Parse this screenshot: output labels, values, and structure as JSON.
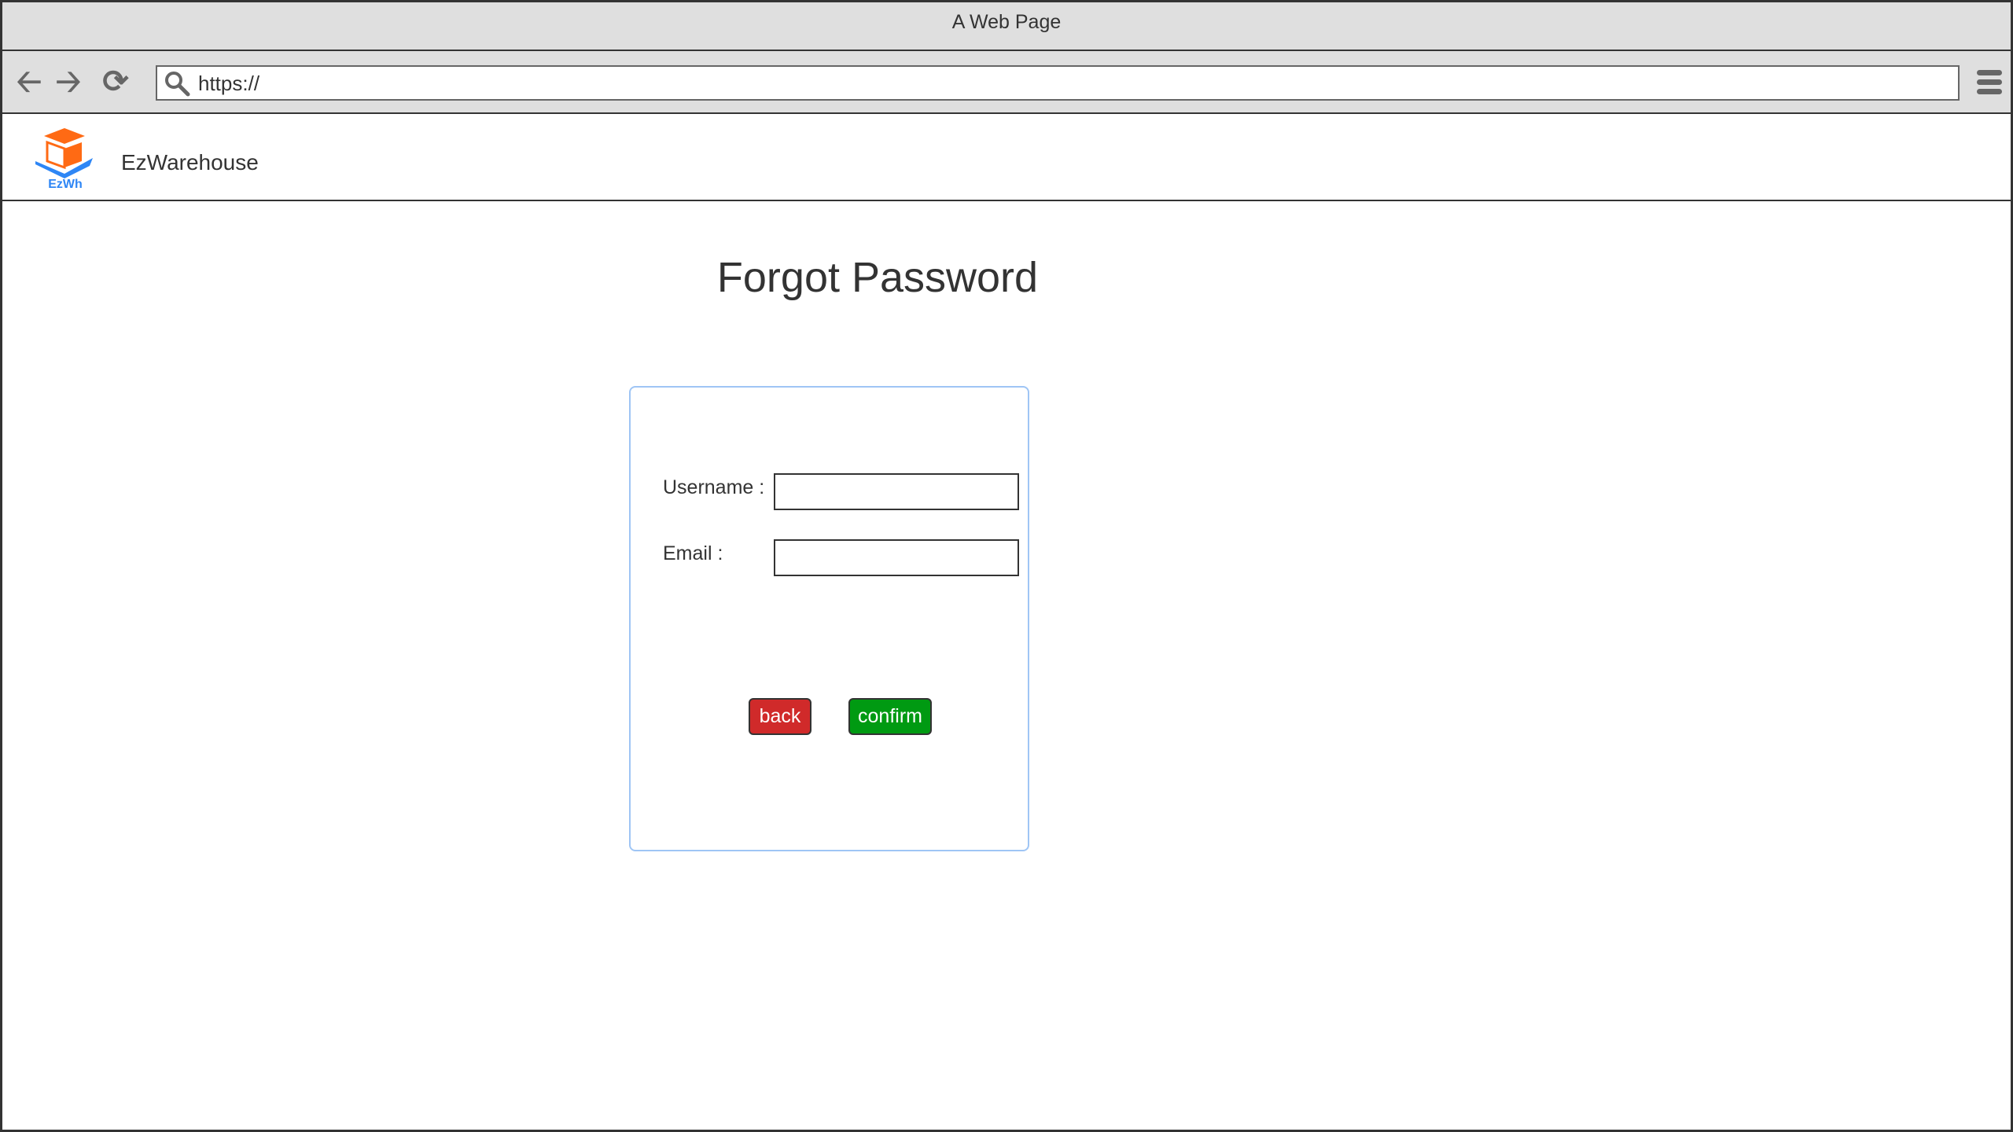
{
  "window": {
    "title": "A Web Page"
  },
  "browser": {
    "url": "https://"
  },
  "header": {
    "brand": "EzWarehouse",
    "logo_text": "EzWh"
  },
  "page": {
    "title": "Forgot Password"
  },
  "form": {
    "username_label": "Username :",
    "username_value": "",
    "email_label": "Email :",
    "email_value": "",
    "back_label": "back",
    "confirm_label": "confirm"
  },
  "colors": {
    "back": "#d02a2a",
    "confirm": "#009a12",
    "card_border": "#9fc5f5",
    "logo_orange": "#ff6a14",
    "logo_blue": "#2e86f5"
  }
}
